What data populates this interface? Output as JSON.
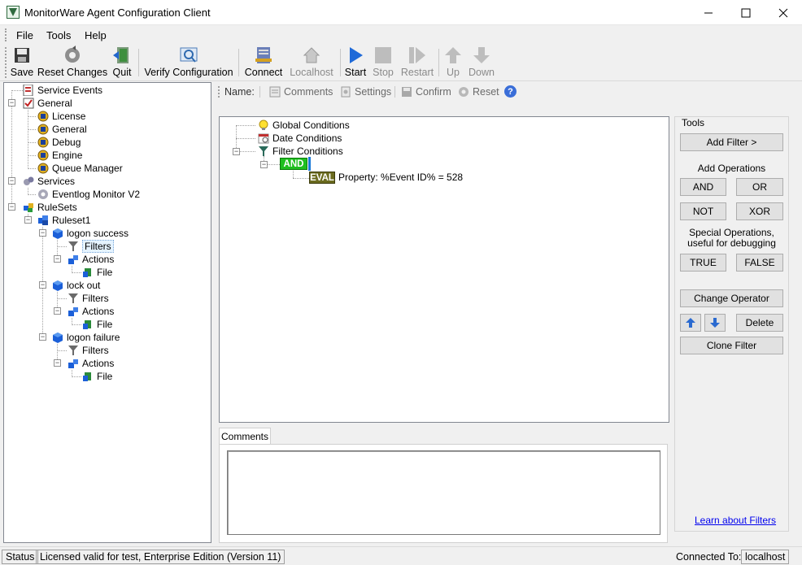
{
  "window": {
    "title": "MonitorWare Agent Configuration Client"
  },
  "menu": {
    "file": "File",
    "tools": "Tools",
    "help": "Help"
  },
  "toolbar": {
    "save": "Save",
    "reset_changes": "Reset Changes",
    "quit": "Quit",
    "verify": "Verify Configuration",
    "connect": "Connect",
    "localhost": "Localhost",
    "start": "Start",
    "stop": "Stop",
    "restart": "Restart",
    "up": "Up",
    "down": "Down"
  },
  "tree": {
    "service_events": "Service Events",
    "general": "General",
    "license": "License",
    "general_child": "General",
    "debug": "Debug",
    "engine": "Engine",
    "queue_manager": "Queue Manager",
    "services": "Services",
    "eventlog_monitor": "Eventlog Monitor V2",
    "rulesets": "RuleSets",
    "ruleset1": "Ruleset1",
    "rule1": "logon success",
    "rule1_filters": "Filters",
    "rule1_actions": "Actions",
    "rule1_file": "File",
    "rule2": "lock out",
    "rule2_filters": "Filters",
    "rule2_actions": "Actions",
    "rule2_file": "File",
    "rule3": "logon failure",
    "rule3_filters": "Filters",
    "rule3_actions": "Actions",
    "rule3_file": "File"
  },
  "subbar": {
    "name_label": "Name:",
    "comments": "Comments",
    "settings": "Settings",
    "confirm": "Confirm",
    "reset": "Reset"
  },
  "filters": {
    "global_conditions": "Global Conditions",
    "date_conditions": "Date Conditions",
    "filter_conditions": "Filter Conditions",
    "and_badge": "AND",
    "eval_badge": "EVAL",
    "eval_text": "Property: %Event ID% = 528"
  },
  "tools": {
    "title": "Tools",
    "add_filter": "Add Filter >",
    "add_operations": "Add Operations",
    "and": "AND",
    "or": "OR",
    "not": "NOT",
    "xor": "XOR",
    "special_ops_line1": "Special Operations,",
    "special_ops_line2": "useful for debugging",
    "true": "TRUE",
    "false": "FALSE",
    "change_operator": "Change Operator",
    "delete": "Delete",
    "clone_filter": "Clone Filter",
    "learn_link": "Learn about Filters"
  },
  "comments": {
    "tab": "Comments",
    "value": ""
  },
  "status": {
    "label": "Status",
    "license": "Licensed valid for test, Enterprise Edition (Version 11)",
    "connected_label": "Connected To:",
    "host": "localhost"
  },
  "colors": {
    "and_badge": "#1fbf1f",
    "eval_badge": "#6b6b1f",
    "link": "#0000ee",
    "cube_blue": "#1b5fd8"
  }
}
